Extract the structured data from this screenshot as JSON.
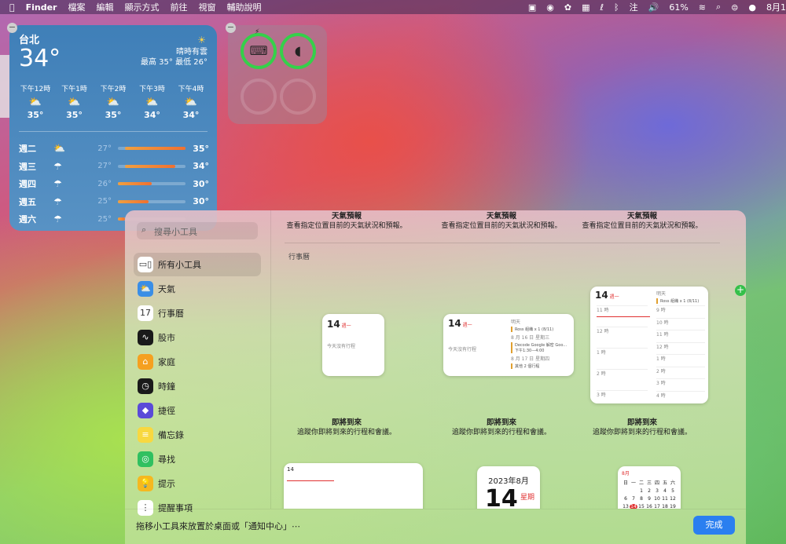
{
  "menubar": {
    "apple": "",
    "app": "Finder",
    "items": [
      "檔案",
      "編輯",
      "顯示方式",
      "前往",
      "視窗",
      "輔助說明"
    ],
    "right": {
      "battery": "61%",
      "input": "注",
      "date": "8月1"
    }
  },
  "weather": {
    "city": "台北",
    "temp": "34°",
    "condition": "晴時有雲",
    "hilo": "最高 35° 最低 26°",
    "hours": [
      {
        "time": "下午12時",
        "icon": "partly-cloudy-icon",
        "temp": "35°"
      },
      {
        "time": "下午1時",
        "icon": "partly-cloudy-icon",
        "temp": "35°"
      },
      {
        "time": "下午2時",
        "icon": "partly-cloudy-icon",
        "temp": "35°"
      },
      {
        "time": "下午3時",
        "icon": "partly-cloudy-icon",
        "temp": "34°"
      },
      {
        "time": "下午4時",
        "icon": "partly-cloudy-icon",
        "temp": "34°"
      }
    ],
    "days": [
      {
        "day": "週二",
        "icon": "partly-cloudy-icon",
        "lo": "27°",
        "hi": "35°",
        "range": [
          0.1,
          1.0
        ]
      },
      {
        "day": "週三",
        "icon": "rain-icon",
        "lo": "27°",
        "hi": "34°",
        "range": [
          0.1,
          0.85
        ]
      },
      {
        "day": "週四",
        "icon": "rain-icon",
        "lo": "26°",
        "hi": "30°",
        "range": [
          0.0,
          0.5
        ]
      },
      {
        "day": "週五",
        "icon": "rain-icon",
        "lo": "25°",
        "hi": "30°",
        "range": [
          0.0,
          0.45
        ]
      },
      {
        "day": "週六",
        "icon": "rain-icon",
        "lo": "25°",
        "hi": "",
        "range": [
          0.0,
          0.1
        ]
      }
    ]
  },
  "battery": {
    "devices": [
      {
        "icon": "laptop-icon",
        "active": true
      },
      {
        "icon": "mouse-icon",
        "active": true
      },
      {
        "icon": "",
        "active": false
      },
      {
        "icon": "",
        "active": false
      }
    ]
  },
  "gallery": {
    "search_placeholder": "搜尋小工具",
    "categories": [
      {
        "label": "所有小工具",
        "icon": "grid-icon",
        "color": "#ffffff"
      },
      {
        "label": "天氣",
        "icon": "weather-app-icon",
        "color": "#3a8ee6"
      },
      {
        "label": "行事曆",
        "icon": "calendar-app-icon",
        "color": "#ffffff"
      },
      {
        "label": "股市",
        "icon": "stocks-app-icon",
        "color": "#1a1a1a"
      },
      {
        "label": "家庭",
        "icon": "home-app-icon",
        "color": "#f5a020"
      },
      {
        "label": "時鐘",
        "icon": "clock-app-icon",
        "color": "#1a1a1a"
      },
      {
        "label": "捷徑",
        "icon": "shortcuts-app-icon",
        "color": "#5a4ad8"
      },
      {
        "label": "備忘錄",
        "icon": "notes-app-icon",
        "color": "#f8d840"
      },
      {
        "label": "尋找",
        "icon": "findmy-app-icon",
        "color": "#30c060"
      },
      {
        "label": "提示",
        "icon": "tips-app-icon",
        "color": "#f5b820"
      },
      {
        "label": "提醒事項",
        "icon": "reminders-app-icon",
        "color": "#ffffff"
      }
    ],
    "weather_descs": [
      {
        "title": "天氣預報",
        "desc": "查看指定位置目前的天氣狀況和預報。"
      },
      {
        "title": "天氣預報",
        "desc": "查看指定位置目前的天氣狀況和預報。"
      },
      {
        "title": "天氣預報",
        "desc": "查看指定位置目前的天氣狀況和預報。"
      }
    ],
    "section": "行事曆",
    "cal_small": {
      "date": "14",
      "dow": "週一",
      "empty": "今天沒有行程"
    },
    "cal_medium": {
      "date": "14",
      "dow": "週一",
      "empty": "今天沒有行程",
      "tomorrow": "明天",
      "ev1": "Ross 組織 x 1 (8/11)",
      "d2": "8 月 16 日 星期三",
      "ev2": "Decode Google 解密 Goo...",
      "ev2t": "下午1:30—4:00",
      "d3": "8 月 17 日 星期四",
      "ev3": "其他 2 個行程"
    },
    "cal_large": {
      "date": "14",
      "dow": "週一",
      "tomorrow": "明天",
      "ev": "Ross 組織 x 1 (8/11)",
      "hours_l": [
        "11 時",
        "12 時",
        "1 時",
        "2 時",
        "3 時"
      ],
      "hours_r": [
        "9 時",
        "10 時",
        "11 時",
        "12 時",
        "1 時",
        "2 時",
        "3 時",
        "4 時"
      ]
    },
    "upnext_descs": [
      {
        "title": "即將到來",
        "desc": "追蹤你即將到來的行程和會議。"
      },
      {
        "title": "即將到來",
        "desc": "追蹤你即將到來的行程和會議。"
      },
      {
        "title": "即將到來",
        "desc": "追蹤你即將到來的行程和會議。"
      }
    ],
    "date_widget": {
      "month": "2023年8月",
      "day": "14",
      "dow": "星期"
    },
    "month_widget": {
      "month": "8月",
      "head": [
        "日",
        "一",
        "二",
        "三",
        "四",
        "五",
        "六"
      ],
      "rows": [
        [
          "",
          "",
          "1",
          "2",
          "3",
          "4",
          "5"
        ],
        [
          "6",
          "7",
          "8",
          "9",
          "10",
          "11",
          "12"
        ],
        [
          "13",
          "14",
          "15",
          "16",
          "17",
          "18",
          "19"
        ]
      ]
    },
    "hint": "拖移小工具來放置於桌面或「通知中心」⋯",
    "done": "完成"
  }
}
